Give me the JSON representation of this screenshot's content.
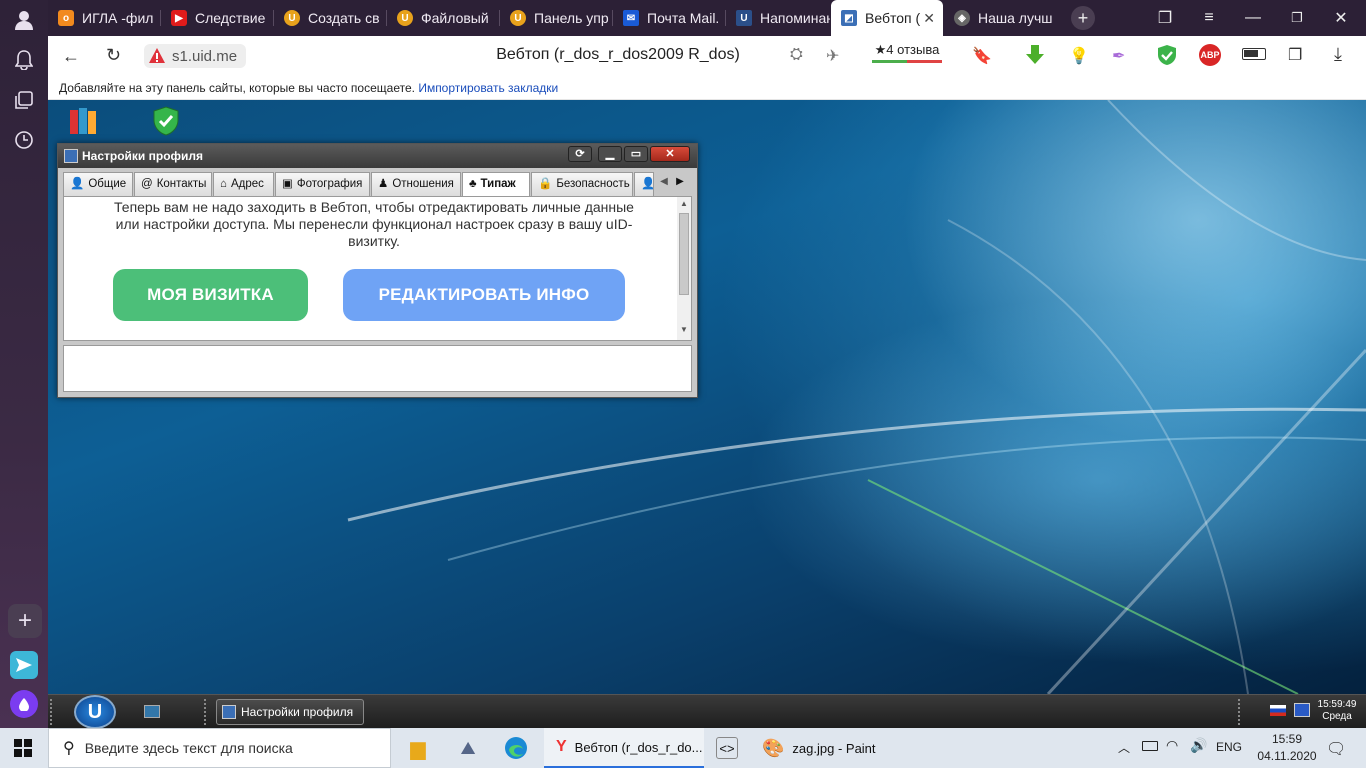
{
  "browser": {
    "tabs": [
      {
        "label": "ИГЛА -фил",
        "fav": "ok-icon",
        "color": "#f28a1e"
      },
      {
        "label": "Следствие",
        "fav": "youtube-icon",
        "color": "#e01b1b"
      },
      {
        "label": "Создать св",
        "fav": "uid-icon",
        "color": "#e8a21c"
      },
      {
        "label": "Файловый",
        "fav": "uid-icon",
        "color": "#e8a21c"
      },
      {
        "label": "Панель упр",
        "fav": "uid-icon",
        "color": "#e8a21c"
      },
      {
        "label": "Почта Mail.",
        "fav": "mail-icon",
        "color": "#1a5bd6"
      },
      {
        "label": "Напоминан",
        "fav": "u-icon",
        "color": "#2b4f8a"
      },
      {
        "label": "Вебтоп (",
        "fav": "webtop-icon",
        "color": "#3b6fb6"
      },
      {
        "label": "Наша лучш",
        "fav": "shield-icon",
        "color": "#666"
      }
    ],
    "url": "s1.uid.me",
    "page_title": "Вебтоп (r_dos_r_dos2009 R_dos)",
    "reviews": "4 отзыва",
    "adblock_label": "ABP",
    "bookmark_hint": "Добавляйте на эту панель сайты, которые вы часто посещаете.",
    "import_link": "Импортировать закладки"
  },
  "desktop": {
    "window": {
      "title": "Настройки профиля",
      "tabs": [
        {
          "label": "Общие",
          "icon": "👤"
        },
        {
          "label": "Контакты",
          "icon": "@"
        },
        {
          "label": "Адрес",
          "icon": "⌂"
        },
        {
          "label": "Фотография",
          "icon": "▣"
        },
        {
          "label": "Отношения",
          "icon": "♟"
        },
        {
          "label": "Типаж",
          "icon": "♣"
        },
        {
          "label": "Безопасность",
          "icon": "🔒"
        }
      ],
      "message": "Теперь вам не надо заходить в Вебтоп, чтобы отредактировать личные данные или настройки доступа. Мы перенесли функционал настроек сразу в вашу uID-визитку.",
      "btn_card": "МОЯ ВИЗИТКА",
      "btn_edit": "РЕДАКТИРОВАТЬ ИНФО",
      "btn_card_color": "#4cbf79",
      "btn_edit_color": "#6fa3f5"
    },
    "taskbar": {
      "task_label": "Настройки профиля",
      "time": "15:59:49",
      "day": "Среда"
    }
  },
  "windows": {
    "search_placeholder": "Введите здесь текст для поиска",
    "apps": [
      {
        "label": "Вебтоп (r_dos_r_do..."
      },
      {
        "label": "zag.jpg - Paint"
      }
    ],
    "lang": "ENG",
    "time": "15:59",
    "date": "04.11.2020"
  }
}
